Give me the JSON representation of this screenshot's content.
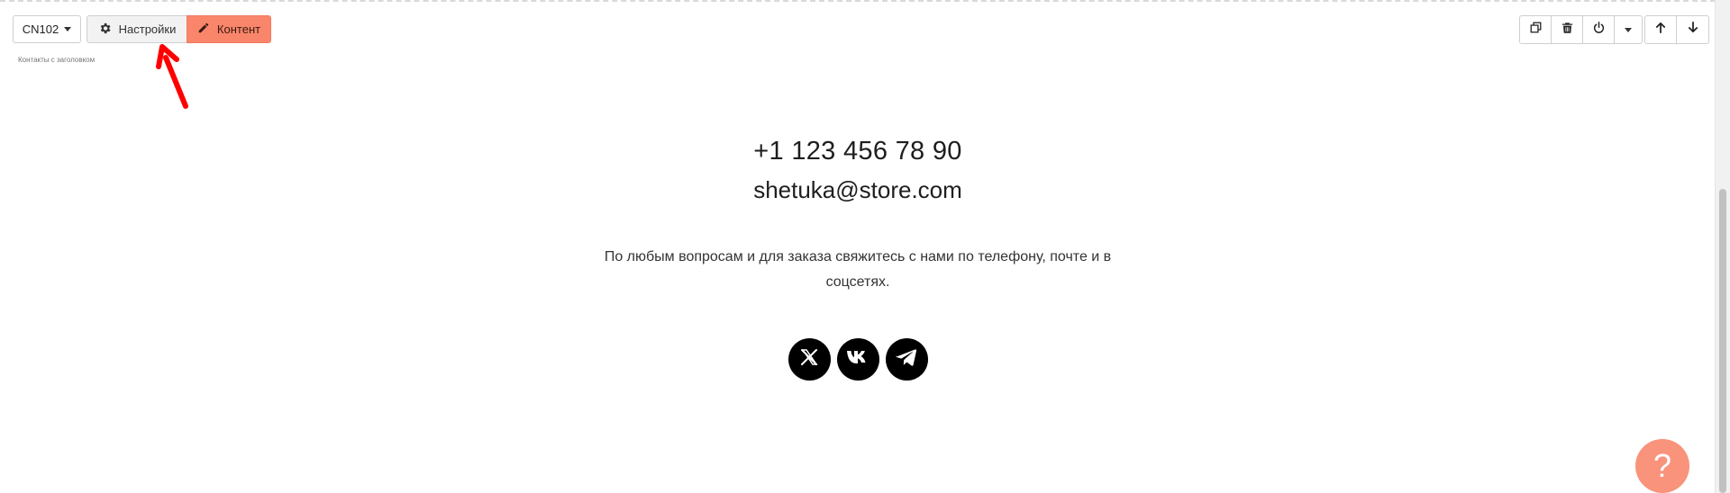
{
  "toolbar": {
    "block_code": "CN102",
    "settings_label": "Настройки",
    "content_label": "Контент",
    "block_caption": "Контакты с заголовком"
  },
  "right_toolbar": {
    "icons": [
      "duplicate-icon",
      "trash-icon",
      "power-icon",
      "caret-down-icon",
      "arrow-up-icon",
      "arrow-down-icon"
    ]
  },
  "contacts": {
    "phone": "+1 123 456 78 90",
    "email": "shetuka@store.com",
    "description": "По любым вопросам и для заказа свяжитесь с нами по телефону, почте и в соцсетях.",
    "socials": [
      "x-icon",
      "vk-icon",
      "telegram-icon"
    ]
  },
  "help": {
    "label": "?"
  },
  "colors": {
    "accent": "#f9866a",
    "annotation": "#ff0000",
    "help_button": "#f9937b"
  }
}
